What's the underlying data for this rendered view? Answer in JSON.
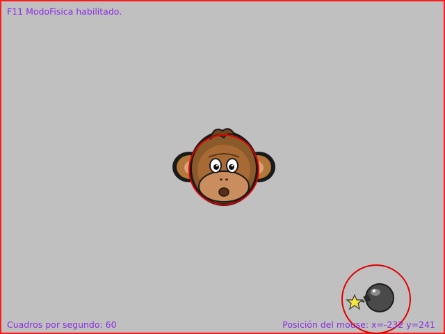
{
  "hud": {
    "mode_status": "F11 ModoFisica habilitado.",
    "fps_label": "Cuadros por segundo: 60",
    "mouse_position_label": "Posición del mouse: x=-232 y=241"
  },
  "actors": [
    {
      "name": "monkey",
      "icon": "monkey-face-icon"
    },
    {
      "name": "bomb",
      "icon": "bomb-icon"
    }
  ],
  "colors": {
    "background": "#c0c0c0",
    "border": "#ff1a1a",
    "hud_text": "#8a2be2",
    "physics_outline": "#e00000"
  }
}
